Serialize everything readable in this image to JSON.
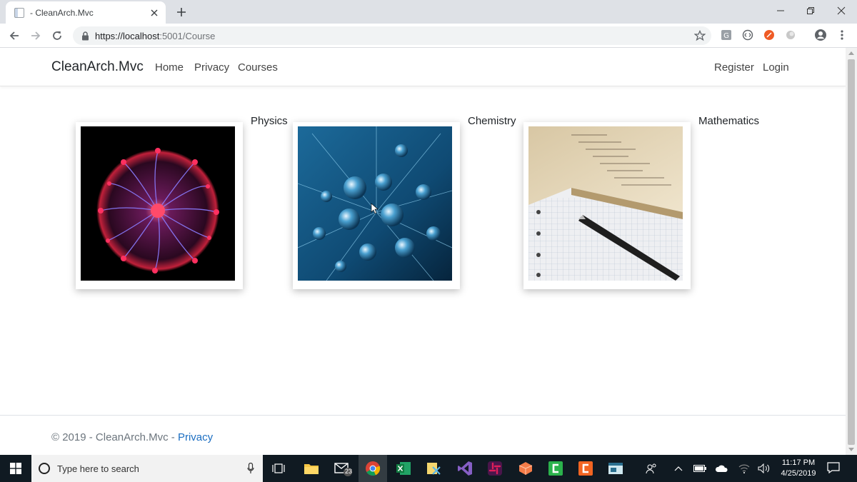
{
  "browser": {
    "tab_title": "- CleanArch.Mvc",
    "url_origin": "https://localhost",
    "url_rest": ":5001/Course"
  },
  "nav": {
    "brand": "CleanArch.Mvc",
    "home": "Home",
    "privacy": "Privacy",
    "courses": "Courses",
    "register": "Register",
    "login": "Login"
  },
  "courses": [
    {
      "name": "Physics",
      "image": "plasma-ball-image"
    },
    {
      "name": "Chemistry",
      "image": "water-drops-image"
    },
    {
      "name": "Mathematics",
      "image": "notebook-pen-image"
    }
  ],
  "footer": {
    "copyright": "© 2019 - CleanArch.Mvc - ",
    "privacy_link": "Privacy"
  },
  "taskbar": {
    "search_placeholder": "Type here to search",
    "mail_badge": "23",
    "time": "11:17 PM",
    "date": "4/25/2019"
  },
  "colors": {
    "link": "#1b6ec2",
    "taskbar": "#101a22",
    "tabstrip": "#dee1e6"
  }
}
